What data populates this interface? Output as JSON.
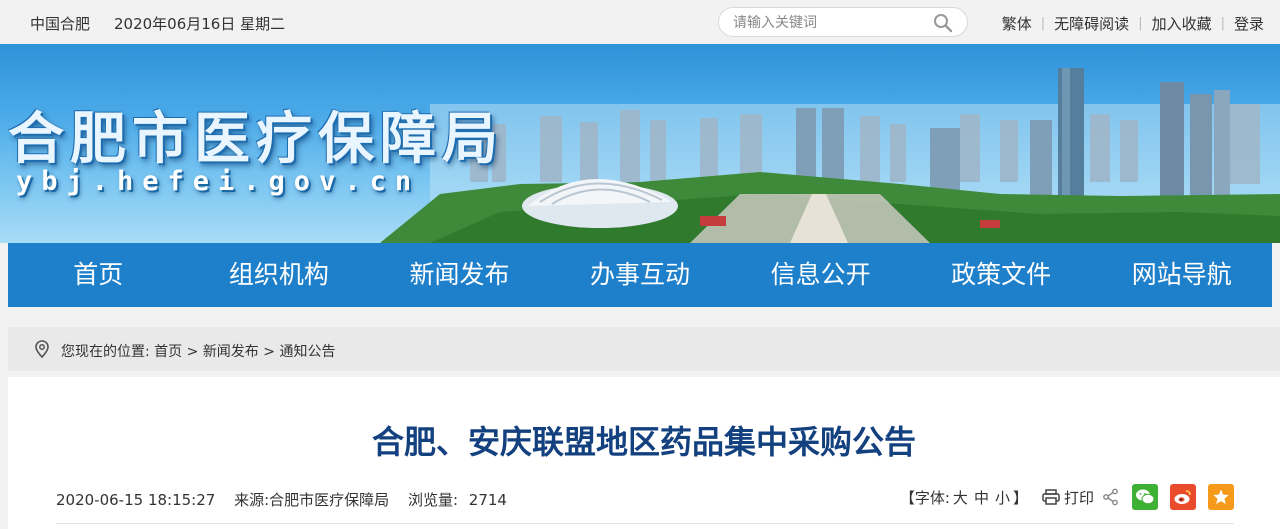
{
  "topbar": {
    "location": "中国合肥",
    "date": "2020年06月16日 星期二",
    "search_placeholder": "请输入关键词",
    "links": [
      "繁体",
      "无障碍阅读",
      "加入收藏",
      "登录"
    ]
  },
  "banner": {
    "title": "合肥市医疗保障局",
    "domain": "ybj.hefei.gov.cn"
  },
  "nav": {
    "items": [
      "首页",
      "组织机构",
      "新闻发布",
      "办事互动",
      "信息公开",
      "政策文件",
      "网站导航"
    ]
  },
  "breadcrumb": {
    "prefix": "您现在的位置:",
    "items": [
      "首页",
      "新闻发布",
      "通知公告"
    ],
    "separator": ">"
  },
  "article": {
    "title": "合肥、安庆联盟地区药品集中采购公告",
    "datetime": "2020-06-15 18:15:27",
    "source": "来源:合肥市医疗保障局",
    "views_label": "浏览量:",
    "views": "2714",
    "font_label_open": "【字体:",
    "font_sizes": [
      "大",
      "中",
      "小"
    ],
    "font_label_close": "】",
    "print_label": "打印"
  },
  "icons": {
    "search": "search-icon",
    "location": "location-pin-icon",
    "print": "printer-icon",
    "share": "share-icon",
    "wechat": "wechat-icon",
    "weibo": "weibo-icon",
    "favorite": "star-icon"
  },
  "colors": {
    "nav_bg": "#1e7fcb",
    "title": "#13407f",
    "wechat": "#3eb135",
    "weibo": "#e94b2b",
    "favorite": "#f59a1b"
  }
}
